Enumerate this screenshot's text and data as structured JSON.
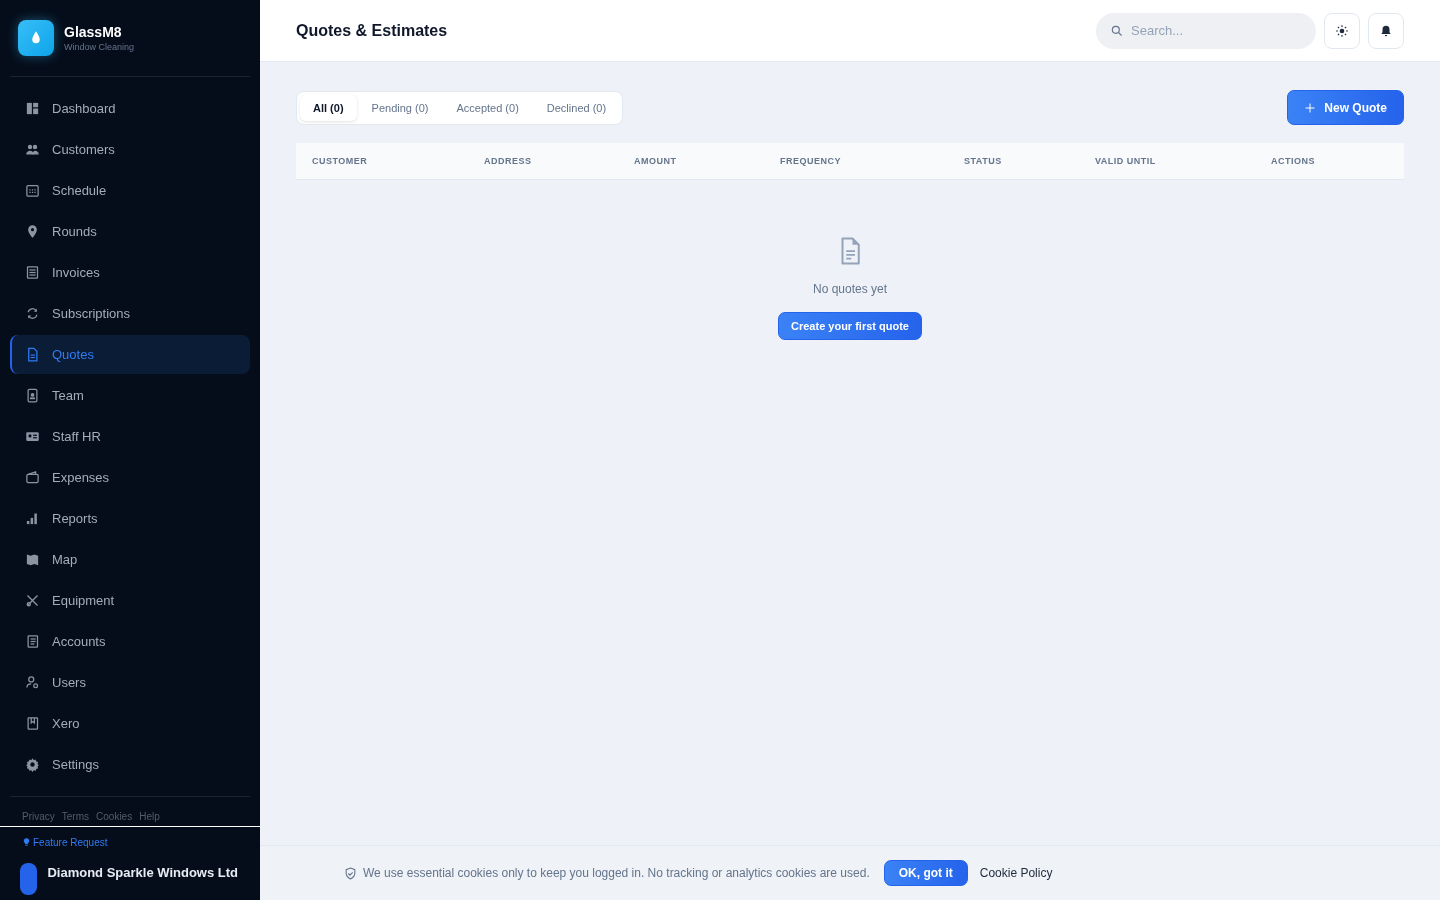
{
  "brand": {
    "name": "GlassM8",
    "tagline": "Window Cleaning"
  },
  "nav": [
    {
      "label": "Dashboard",
      "selected": false
    },
    {
      "label": "Customers",
      "selected": false
    },
    {
      "label": "Schedule",
      "selected": false
    },
    {
      "label": "Rounds",
      "selected": false
    },
    {
      "label": "Invoices",
      "selected": false
    },
    {
      "label": "Subscriptions",
      "selected": false
    },
    {
      "label": "Quotes",
      "selected": true
    },
    {
      "label": "Team",
      "selected": false
    },
    {
      "label": "Staff HR",
      "selected": false
    },
    {
      "label": "Expenses",
      "selected": false
    },
    {
      "label": "Reports",
      "selected": false
    },
    {
      "label": "Map",
      "selected": false
    },
    {
      "label": "Equipment",
      "selected": false
    },
    {
      "label": "Accounts",
      "selected": false
    },
    {
      "label": "Users",
      "selected": false
    },
    {
      "label": "Xero",
      "selected": false
    },
    {
      "label": "Settings",
      "selected": false
    }
  ],
  "footer_links": [
    "Privacy",
    "Terms",
    "Cookies",
    "Help"
  ],
  "feature_request": "Feature Request",
  "account": {
    "name": "Diamond Sparkle Windows Ltd"
  },
  "header": {
    "title": "Quotes & Estimates",
    "search": {
      "placeholder": "Search..."
    }
  },
  "tabs": [
    {
      "label": "All (0)",
      "selected": true
    },
    {
      "label": "Pending (0)",
      "selected": false
    },
    {
      "label": "Accepted (0)",
      "selected": false
    },
    {
      "label": "Declined (0)",
      "selected": false
    }
  ],
  "new_button": "New Quote",
  "table": {
    "columns": [
      "CUSTOMER",
      "ADDRESS",
      "AMOUNT",
      "FREQUENCY",
      "STATUS",
      "VALID UNTIL",
      "ACTIONS"
    ]
  },
  "empty": {
    "message": "No quotes yet",
    "button": "Create your first quote"
  },
  "cookie_banner": {
    "text": "We use essential cookies only to keep you logged in. No tracking or analytics cookies are used.",
    "accept": "OK, got it",
    "policy": "Cookie Policy"
  }
}
